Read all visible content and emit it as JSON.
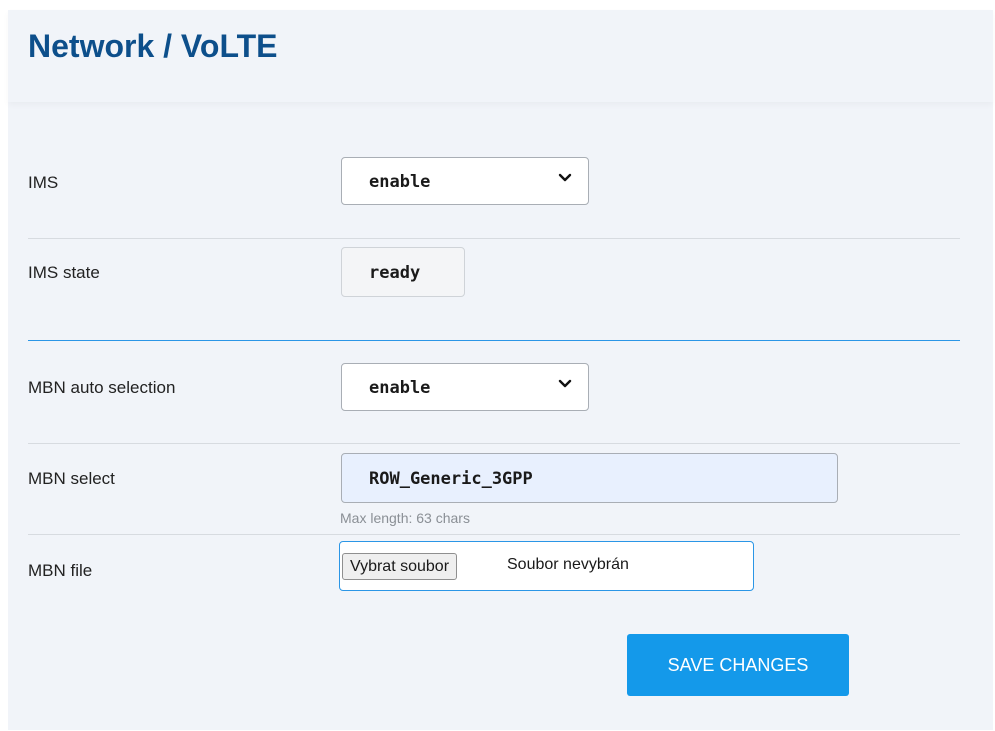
{
  "header": {
    "title": "Network / VoLTE"
  },
  "form": {
    "ims": {
      "label": "IMS",
      "value": "enable"
    },
    "ims_state": {
      "label": "IMS state",
      "value": "ready"
    },
    "mbn_auto_selection": {
      "label": "MBN auto selection",
      "value": "enable"
    },
    "mbn_select": {
      "label": "MBN select",
      "value": "ROW_Generic_3GPP",
      "hint": "Max length:  63 chars"
    },
    "mbn_file": {
      "label": "MBN file",
      "button_label": "Vybrat soubor",
      "status": "Soubor nevybrán"
    }
  },
  "actions": {
    "save_label": "SAVE CHANGES"
  },
  "colors": {
    "title": "#0d4f8b",
    "accent": "#1499ea",
    "panel_background": "#f1f4f9"
  },
  "icons": {
    "dropdown": "chevron-down-icon"
  }
}
